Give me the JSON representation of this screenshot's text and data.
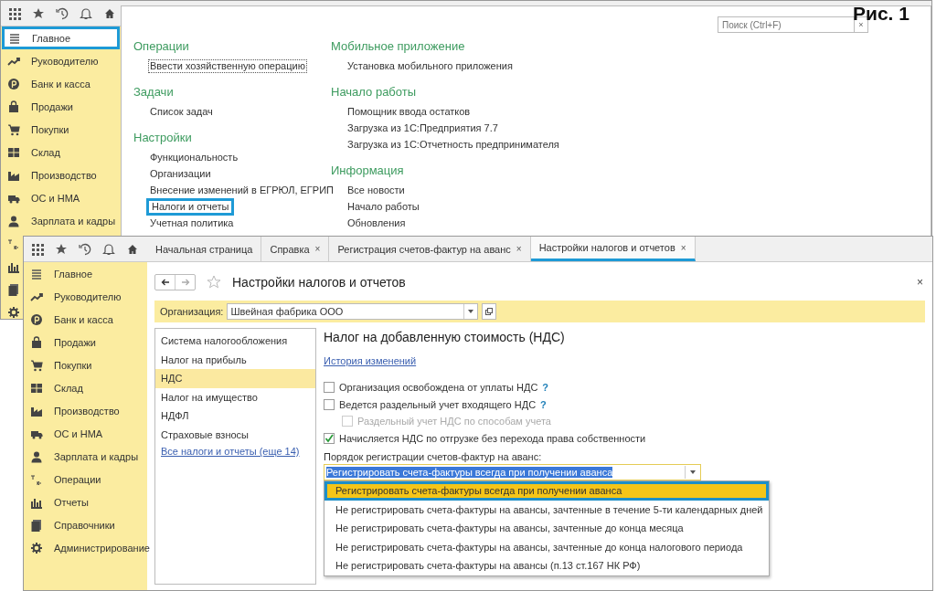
{
  "caption": "Рис. 1",
  "back_window": {
    "sidebar": {
      "items": [
        {
          "kind": "labeled",
          "label": "Главное",
          "highlighted": true
        },
        {
          "kind": "labeled",
          "label": "Руководителю",
          "highlighted": false
        },
        {
          "kind": "labeled",
          "label": "Банк и касса",
          "highlighted": false
        },
        {
          "kind": "labeled",
          "label": "Продажи",
          "highlighted": false
        },
        {
          "kind": "labeled",
          "label": "Покупки",
          "highlighted": false
        },
        {
          "kind": "labeled",
          "label": "Склад",
          "highlighted": false
        },
        {
          "kind": "labeled",
          "label": "Производство",
          "highlighted": false
        },
        {
          "kind": "labeled",
          "label": "ОС и НМА",
          "highlighted": false
        },
        {
          "kind": "labeled",
          "label": "Зарплата и кадры",
          "highlighted": false
        },
        {
          "kind": "icon_only"
        },
        {
          "kind": "icon_only"
        },
        {
          "kind": "icon_only"
        },
        {
          "kind": "icon_only"
        }
      ]
    },
    "search": {
      "placeholder": "Поиск (Ctrl+F)",
      "clear": "×"
    },
    "columns": [
      [
        {
          "title": "Операции",
          "links": [
            {
              "label": "Ввести хозяйственную операцию",
              "focused": true,
              "highlighted": false
            }
          ]
        },
        {
          "title": "Задачи",
          "links": [
            {
              "label": "Список задач",
              "focused": false,
              "highlighted": false
            }
          ]
        },
        {
          "title": "Настройки",
          "links": [
            {
              "label": "Функциональность",
              "focused": false,
              "highlighted": false
            },
            {
              "label": "Организации",
              "focused": false,
              "highlighted": false
            },
            {
              "label": "Внесение изменений в ЕГРЮЛ, ЕГРИП",
              "focused": false,
              "highlighted": false
            },
            {
              "label": "Налоги и отчеты",
              "focused": false,
              "highlighted": true
            },
            {
              "label": "Учетная политика",
              "focused": false,
              "highlighted": false
            }
          ]
        }
      ],
      [
        {
          "title": "Мобильное приложение",
          "links": [
            {
              "label": "Установка мобильного приложения",
              "focused": false,
              "highlighted": false
            }
          ]
        },
        {
          "title": "Начало работы",
          "links": [
            {
              "label": "Помощник ввода остатков",
              "focused": false,
              "highlighted": false
            },
            {
              "label": "Загрузка из 1С:Предприятия 7.7",
              "focused": false,
              "highlighted": false
            },
            {
              "label": "Загрузка из 1С:Отчетность предпринимателя",
              "focused": false,
              "highlighted": false
            }
          ]
        },
        {
          "title": "Информация",
          "links": [
            {
              "label": "Все новости",
              "focused": false,
              "highlighted": false
            },
            {
              "label": "Начало работы",
              "focused": false,
              "highlighted": false
            },
            {
              "label": "Обновления",
              "focused": false,
              "highlighted": false
            }
          ]
        }
      ]
    ]
  },
  "front_window": {
    "tabs": [
      {
        "kind": "home",
        "label": "Начальная страница",
        "selected": false
      },
      {
        "kind": "closable",
        "label": "Справка",
        "close": "×",
        "selected": false
      },
      {
        "kind": "closable",
        "label": "Регистрация счетов-фактур на аванс",
        "close": "×",
        "selected": false
      },
      {
        "kind": "closable",
        "label": "Настройки налогов и отчетов",
        "close": "×",
        "selected": true
      }
    ],
    "sidebar": {
      "items": [
        {
          "label": "Главное"
        },
        {
          "label": "Руководителю"
        },
        {
          "label": "Банк и касса"
        },
        {
          "label": "Продажи"
        },
        {
          "label": "Покупки"
        },
        {
          "label": "Склад"
        },
        {
          "label": "Производство"
        },
        {
          "label": "ОС и НМА"
        },
        {
          "label": "Зарплата и кадры"
        },
        {
          "label": "Операции"
        },
        {
          "label": "Отчеты"
        },
        {
          "label": "Справочники"
        },
        {
          "label": "Администрирование"
        }
      ]
    },
    "title": "Настройки налогов и отчетов",
    "close": "×",
    "organization": {
      "label": "Организация:",
      "value": "Швейная фабрика ООО"
    },
    "sections": {
      "items": [
        {
          "label": "Система налогообложения",
          "selected": false
        },
        {
          "label": "Налог на прибыль",
          "selected": false
        },
        {
          "label": "НДС",
          "selected": true
        },
        {
          "label": "Налог на имущество",
          "selected": false
        },
        {
          "label": "НДФЛ",
          "selected": false
        },
        {
          "label": "Страховые взносы",
          "selected": false
        }
      ],
      "more_link": "Все налоги и отчеты (еще 14)"
    },
    "panel": {
      "heading": "Налог на добавленную стоимость (НДС)",
      "history_link": "История изменений",
      "options": [
        {
          "label": "Организация освобождена от уплаты НДС",
          "checked": false,
          "disabled": false,
          "help": "?"
        },
        {
          "label": "Ведется раздельный учет входящего НДС",
          "checked": false,
          "disabled": false,
          "help": "?",
          "children": [
            {
              "label": "Раздельный учет НДС по способам учета",
              "checked": false,
              "disabled": true
            }
          ]
        },
        {
          "label": "Начисляется НДС по отгрузке без перехода права собственности",
          "checked": true,
          "disabled": false
        }
      ],
      "advance_order": {
        "label": "Порядок регистрации счетов-фактур на аванс:",
        "value": "Регистрировать счета-фактуры всегда при получении аванса",
        "text_selected": true,
        "expanded": true,
        "options": [
          {
            "label": "Регистрировать счета-фактуры всегда при получении аванса",
            "selected": true,
            "highlighted": true
          },
          {
            "label": "Не регистрировать счета-фактуры на авансы, зачтенные в течение 5-ти календарных дней",
            "selected": false,
            "highlighted": false
          },
          {
            "label": "Не регистрировать счета-фактуры на авансы, зачтенные до конца месяца",
            "selected": false,
            "highlighted": false
          },
          {
            "label": "Не регистрировать счета-фактуры на авансы, зачтенные до конца налогового периода",
            "selected": false,
            "highlighted": false
          },
          {
            "label": "Не регистрировать счета-фактуры на авансы (п.13 ст.167 НК РФ)",
            "selected": false,
            "highlighted": false
          }
        ]
      }
    }
  }
}
